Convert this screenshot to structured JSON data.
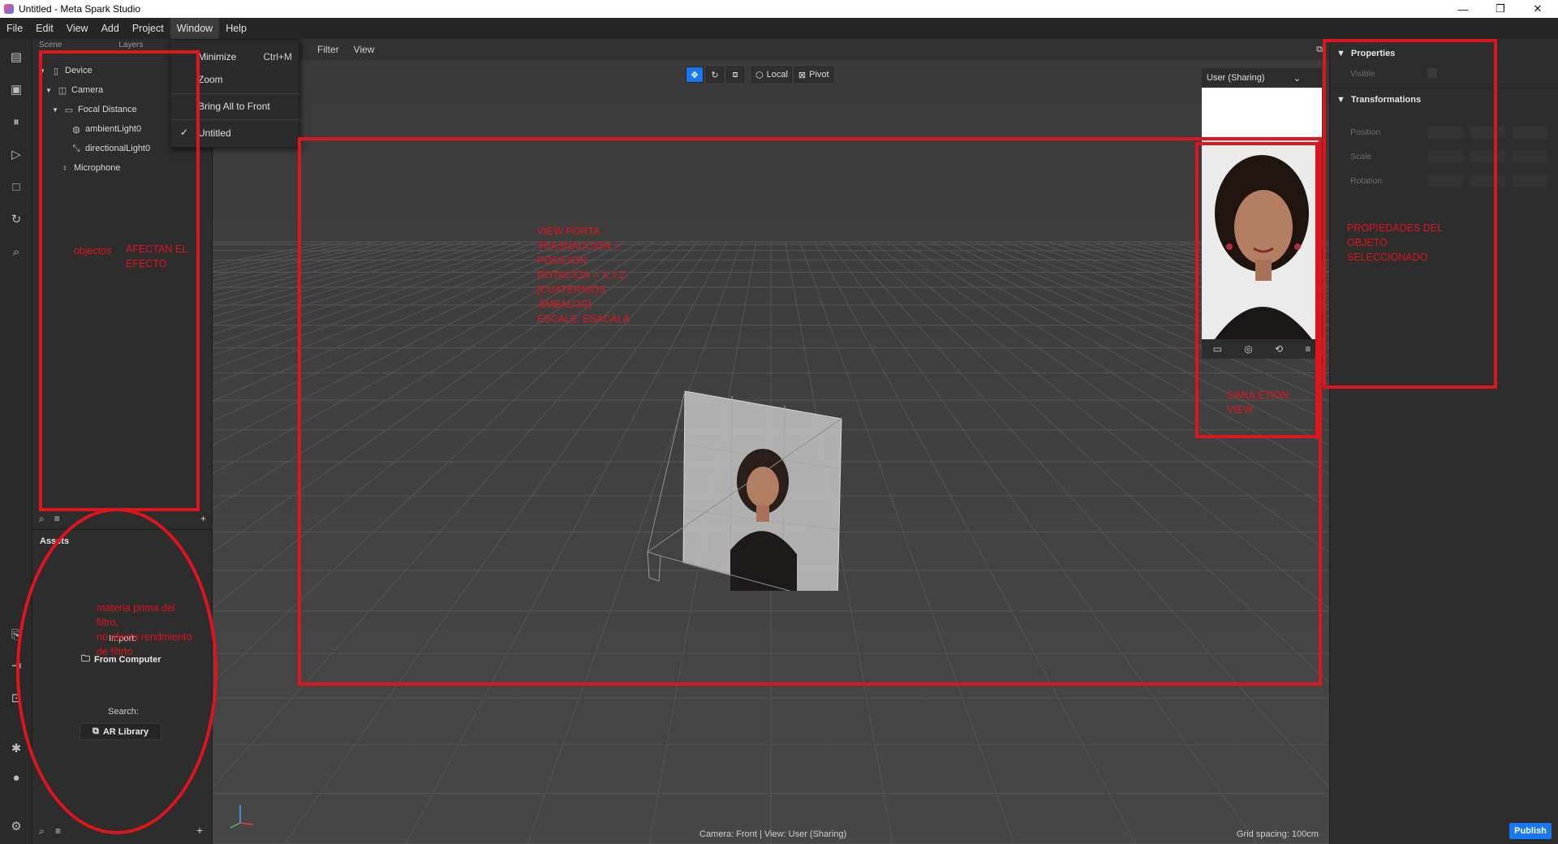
{
  "window": {
    "title": "Untitled - Meta Spark Studio",
    "min": "—",
    "max": "❐",
    "close": "✕"
  },
  "menubar": {
    "items": [
      "File",
      "Edit",
      "View",
      "Add",
      "Project",
      "Window",
      "Help"
    ]
  },
  "window_menu": {
    "minimize": "Minimize",
    "minimize_shortcut": "Ctrl+M",
    "zoom": "Zoom",
    "bring_all": "Bring All to Front",
    "check": "✓",
    "untitled": "Untitled"
  },
  "scene": {
    "header_left": "Scene",
    "header_right": "Layers",
    "tree": [
      {
        "label": "Device",
        "icon": "phone-icon"
      },
      {
        "label": "Camera",
        "icon": "camera-icon"
      },
      {
        "label": "Focal Distance",
        "icon": "focal-distance-icon"
      },
      {
        "label": "ambientLight0",
        "icon": "globe-icon"
      },
      {
        "label": "directionalLight0",
        "icon": "directional-light-icon"
      },
      {
        "label": "Microphone",
        "icon": "microphone-icon"
      }
    ]
  },
  "assets": {
    "title": "Assets",
    "import_label": "Import:",
    "from_computer": "From Computer",
    "search_label": "Search:",
    "ar_library": "AR Library"
  },
  "viewport": {
    "menu": [
      "Filter",
      "View"
    ],
    "toolbar": {
      "local": "Local",
      "pivot": "Pivot"
    },
    "status_camera": "Camera: Front | View: User (Sharing)",
    "grid_spacing": "Grid spacing: 100cm"
  },
  "simulator": {
    "device": "User (Sharing)"
  },
  "properties": {
    "section_properties": "Properties",
    "visible": "Visible",
    "section_transformations": "Transformations",
    "position": "Position",
    "scale": "Scale",
    "rotation": "Rotation"
  },
  "publish": "Publish",
  "annotations": {
    "objects": "objectos",
    "affect": "AFECTAN EL\nEFECTO",
    "materia": "materia prima del\nfiltro,\nno afecta rendmiento\nde filtrto",
    "view_porta": "VIEW PORTA\nTRASNACCION =\nPOSICION\nROTACION = X,Y,Z\n[CUATERNIOS\nJIMBALOG]\nESCALE: ESACALA",
    "simulation": "SIMULETION\nVIEW",
    "propiedades": "PROPIEDADES DEL\nOBJETO\nSELECCIONADO"
  },
  "colors": {
    "accent": "#1877f2",
    "annotation": "#e0141c",
    "background": "#3f3f3f"
  }
}
